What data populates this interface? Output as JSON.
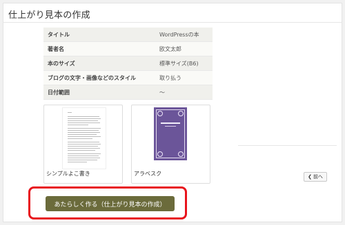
{
  "page": {
    "title": "仕上がり見本の作成"
  },
  "info_rows": [
    {
      "label": "タイトル",
      "value": "WordPressの本"
    },
    {
      "label": "著者名",
      "value": "欧文太郎"
    },
    {
      "label": "本のサイズ",
      "value": "標準サイズ(B6)"
    },
    {
      "label": "ブログの文字・画像などのスタイル",
      "value": "取り払う"
    },
    {
      "label": "日付範囲",
      "value": "〜"
    }
  ],
  "templates": [
    {
      "name": "シンプルよこ書き",
      "thumbnail": "document-thumbnail"
    },
    {
      "name": "アラベスク",
      "thumbnail": "purple-cover-thumbnail",
      "color": "#6b5599"
    }
  ],
  "nav": {
    "prev_label": "前へ",
    "prev_icon": "chevron-left-icon"
  },
  "actions": {
    "create_label": "あたらしく作る（仕上がり見本の作成）"
  },
  "colors": {
    "create_button": "#6b6b3b",
    "highlight": "#e8141c"
  }
}
